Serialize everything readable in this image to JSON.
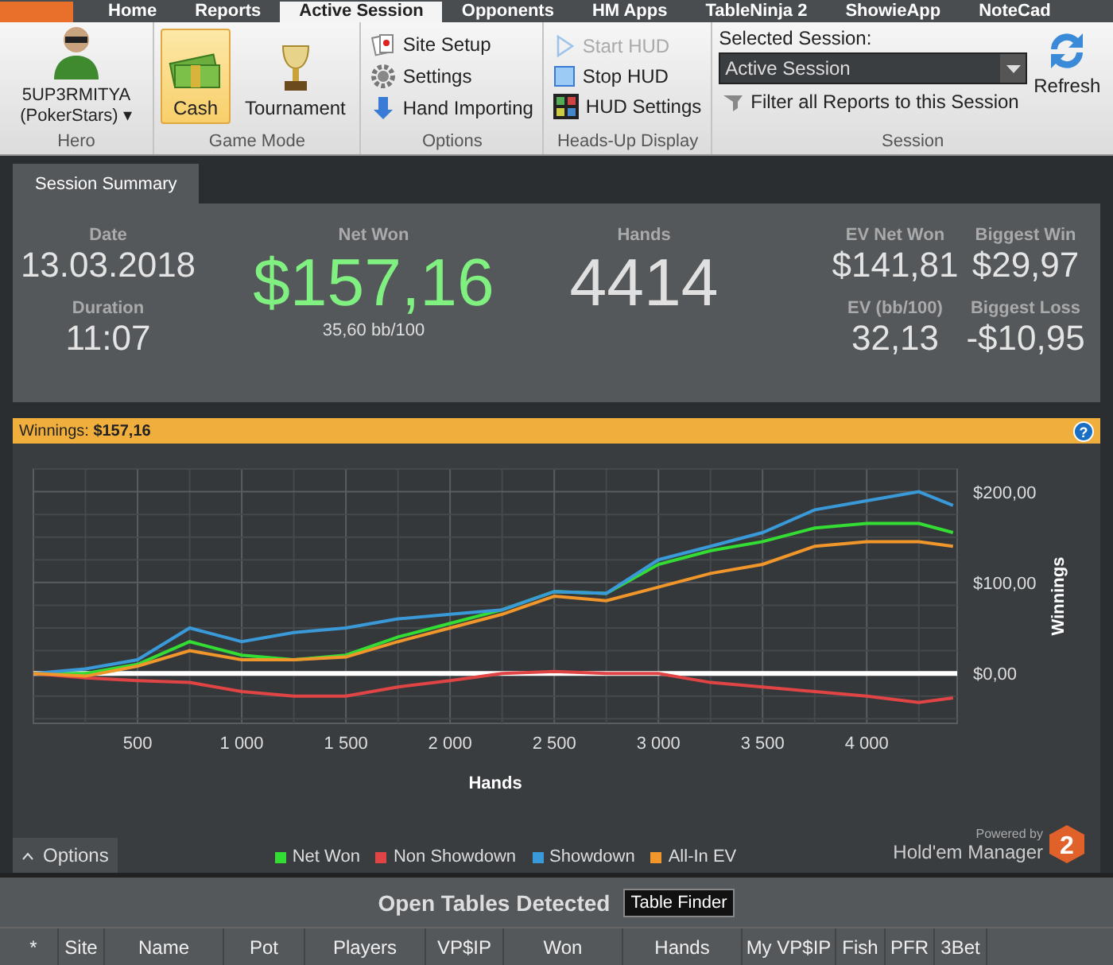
{
  "top_tabs": [
    {
      "label": "Home",
      "selected": false
    },
    {
      "label": "Reports",
      "selected": false
    },
    {
      "label": "Active Session",
      "selected": true
    },
    {
      "label": "Opponents",
      "selected": false
    },
    {
      "label": "HM Apps",
      "selected": false
    },
    {
      "label": "TableNinja 2",
      "selected": false
    },
    {
      "label": "ShowieApp",
      "selected": false
    },
    {
      "label": "NoteCad",
      "selected": false
    }
  ],
  "hero": {
    "name": "5UP3RMITYA",
    "site": "(PokerStars)",
    "caret": "▾",
    "label": "Hero"
  },
  "game_mode": {
    "label": "Game Mode",
    "buttons": [
      {
        "label": "Cash",
        "selected": true
      },
      {
        "label": "Tournament",
        "selected": false
      }
    ]
  },
  "options": {
    "label": "Options",
    "items": [
      {
        "label": "Site Setup",
        "disabled": false
      },
      {
        "label": "Settings",
        "disabled": false
      },
      {
        "label": "Hand Importing",
        "disabled": false
      }
    ]
  },
  "hud": {
    "label": "Heads-Up Display",
    "items": [
      {
        "label": "Start HUD",
        "disabled": true
      },
      {
        "label": "Stop HUD",
        "disabled": false
      },
      {
        "label": "HUD Settings",
        "disabled": false
      }
    ]
  },
  "session": {
    "label": "Session",
    "caption": "Selected Session:",
    "value": "Active Session",
    "filter": "Filter all Reports to this Session",
    "refresh": "Refresh"
  },
  "panel_tabs": [
    {
      "label": "Session Summary",
      "selected": true
    }
  ],
  "summary": {
    "date": {
      "label": "Date",
      "value": "13.03.2018"
    },
    "duration": {
      "label": "Duration",
      "value": "11:07"
    },
    "net_won": {
      "label": "Net Won",
      "value": "$157,16",
      "sub": "35,60 bb/100"
    },
    "hands": {
      "label": "Hands",
      "value": "4414"
    },
    "ev_net_won": {
      "label": "EV Net Won",
      "value": "$141,81"
    },
    "biggest_win": {
      "label": "Biggest Win",
      "value": "$29,97"
    },
    "ev_bb_100": {
      "label": "EV (bb/100)",
      "value": "32,13"
    },
    "biggest_loss": {
      "label": "Biggest Loss",
      "value": "-$10,95"
    }
  },
  "winnings_bar": {
    "label": "Winnings:",
    "value": "$157,16",
    "help": "?"
  },
  "chart_data": {
    "type": "line",
    "xlabel": "Hands",
    "ylabel": "Winnings",
    "x": [
      0,
      250,
      500,
      750,
      1000,
      1250,
      1500,
      1750,
      2000,
      2250,
      2500,
      2750,
      3000,
      3250,
      3500,
      3750,
      4000,
      4250,
      4414
    ],
    "series": [
      {
        "name": "Net Won",
        "color": "#33dd33",
        "values": [
          0,
          0,
          10,
          35,
          20,
          15,
          20,
          40,
          55,
          70,
          90,
          88,
          120,
          135,
          145,
          160,
          165,
          165,
          155
        ]
      },
      {
        "name": "Non Showdown",
        "color": "#e04444",
        "values": [
          0,
          -5,
          -8,
          -10,
          -20,
          -25,
          -25,
          -15,
          -8,
          0,
          2,
          0,
          0,
          -10,
          -15,
          -20,
          -25,
          -32,
          -27
        ]
      },
      {
        "name": "Showdown",
        "color": "#3a9ad9",
        "values": [
          0,
          5,
          15,
          50,
          35,
          45,
          50,
          60,
          65,
          70,
          90,
          88,
          125,
          140,
          155,
          180,
          190,
          200,
          185
        ]
      },
      {
        "name": "All-In EV",
        "color": "#f0962a",
        "values": [
          0,
          -3,
          8,
          25,
          15,
          15,
          18,
          35,
          50,
          65,
          85,
          80,
          95,
          110,
          120,
          140,
          145,
          145,
          140
        ]
      }
    ],
    "xlim": [
      0,
      4434
    ],
    "ylim": [
      -55,
      225
    ],
    "grid": true,
    "xticks": [
      {
        "value": 500,
        "label": "500"
      },
      {
        "value": 1000,
        "label": "1 000"
      },
      {
        "value": 1500,
        "label": "1 500"
      },
      {
        "value": 2000,
        "label": "2 000"
      },
      {
        "value": 2500,
        "label": "2 500"
      },
      {
        "value": 3000,
        "label": "3 000"
      },
      {
        "value": 3500,
        "label": "3 500"
      },
      {
        "value": 4000,
        "label": "4 000"
      }
    ],
    "yticks": [
      {
        "value": 0,
        "label": "$0,00"
      },
      {
        "value": 100,
        "label": "$100,00"
      },
      {
        "value": 200,
        "label": "$200,00"
      }
    ]
  },
  "options_button": "Options",
  "brand": {
    "powered": "Powered by",
    "name": "Hold'em Manager",
    "badge": "2"
  },
  "open_tables": {
    "title": "Open Tables Detected",
    "button": "Table Finder",
    "columns": [
      "*",
      "Site",
      "Name",
      "Pot",
      "Players",
      "VP$IP",
      "Won",
      "Hands",
      "My VP$IP",
      "Fish",
      "PFR",
      "3Bet"
    ]
  }
}
